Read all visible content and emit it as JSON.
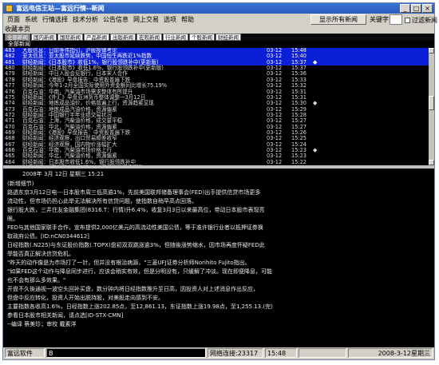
{
  "window": {
    "title": "富远电信王站—富远行情--新闻",
    "min": "_",
    "max": "□",
    "close": "×"
  },
  "menu": [
    "页面",
    "系统",
    "行情选择",
    "技术分析",
    "公告信息",
    "网上交易",
    "选项",
    "帮助"
  ],
  "toolbar": {
    "show_all_button": "显示所有新闻",
    "keyword_label": "关键字:",
    "keyword_value": "",
    "filter_label": "过滤新闻",
    "filter_checked": false
  },
  "breadcrumb": "收藏本页",
  "tabs": [
    {
      "label": "全部新闻",
      "active": true
    },
    {
      "label": "国内新闻",
      "active": false
    },
    {
      "label": "国际新闻",
      "active": false
    },
    {
      "label": "产品新闻",
      "active": false
    },
    {
      "label": "出版新闻",
      "active": false
    },
    {
      "label": "宏观新闻",
      "active": false
    },
    {
      "label": "行业新闻",
      "active": false
    },
    {
      "label": "个股新闻",
      "active": false
    },
    {
      "label": "财经新闻",
      "active": false
    }
  ],
  "list_header": "全部新闻",
  "news": [
    {
      "id": "483",
      "title": "大股信息：日前等伟指引，沪股按律考论",
      "date": "03-12",
      "time": "15:48",
      "mark": "",
      "state": "hl"
    },
    {
      "id": "482",
      "title": "亚太信息：亚太股市延续跌势，中国恒生再跌近1%指数",
      "date": "03-12",
      "time": "15:40",
      "mark": "",
      "state": "hl"
    },
    {
      "id": "481",
      "title": "财经新闻：《日本股市》收低1%，银行股领跌补中(更新版)",
      "date": "03-12",
      "time": "15:37",
      "mark": "◆",
      "state": "sel"
    },
    {
      "id": "480",
      "title": "财经新闻：《日本股市》收低1.6%，银行股领跌补中(更新版)",
      "date": "03-12",
      "time": "15:37",
      "mark": "",
      "state": ""
    },
    {
      "id": "479",
      "title": "财经新闻：中日入股会见银行，日本宋人合作",
      "date": "03-12",
      "time": "15:36",
      "mark": "",
      "state": ""
    },
    {
      "id": "478",
      "title": "财经新闻：《港股》早盘报告：中资股普遍下跌",
      "date": "03-12",
      "time": "15:33",
      "mark": "",
      "state": ""
    },
    {
      "id": "477",
      "title": "财经新闻：今年1-2月全国实际使用外资金额同比增长75.19%",
      "date": "03-12",
      "time": "15:32",
      "mark": "",
      "state": ""
    },
    {
      "id": "476",
      "title": "百克石油：华南，汽柴油市场需求整体有所提升",
      "date": "03-12",
      "time": "15:31",
      "mark": "",
      "state": ""
    },
    {
      "id": "475",
      "title": "财经新闻：《外汇》早盘亚洲货币整体调整一3月12日",
      "date": "03-12",
      "time": "15:31",
      "mark": "",
      "state": ""
    },
    {
      "id": "474",
      "title": "财经新闻：地炼成品油价，价格普遍上行，资源趋紧显现",
      "date": "03-12",
      "time": "15:30",
      "mark": "◆",
      "state": ""
    },
    {
      "id": "473",
      "title": "百克石油：地炼成品汽油价格，资源偏紧",
      "date": "03-12",
      "time": "15:29",
      "mark": "",
      "state": ""
    },
    {
      "id": "472",
      "title": "财经新闻：中国银行半年业绩交易状况",
      "date": "03-12",
      "time": "15:28",
      "mark": "",
      "state": ""
    },
    {
      "id": "471",
      "title": "百克石油：上海，汽柴油价格，成交量平稳",
      "date": "03-12",
      "time": "15:27",
      "mark": "",
      "state": ""
    },
    {
      "id": "470",
      "title": "百克石油：华北，汽柴油价格，资源偏紧",
      "date": "03-12",
      "time": "15:27",
      "mark": "",
      "state": ""
    },
    {
      "id": "469",
      "title": "财经新闻：《港股》早盘报告：中资股普遍下跌",
      "date": "03-12",
      "time": "15:26",
      "mark": "",
      "state": ""
    },
    {
      "id": "468",
      "title": "财经新闻：经济观察，出口贸易顺差收窄",
      "date": "03-12",
      "time": "15:25",
      "mark": "",
      "state": ""
    },
    {
      "id": "467",
      "title": "财经新闻：经济观察，国内物价涨幅扩大",
      "date": "03-12",
      "time": "15:24",
      "mark": "",
      "state": ""
    },
    {
      "id": "466",
      "title": "百克石油：华南，汽柴油市场价格上行",
      "date": "03-12",
      "time": "15:23",
      "mark": "◆",
      "state": ""
    },
    {
      "id": "465",
      "title": "财经新闻：华北，汽柴油价格，资源偏紧",
      "date": "03-12",
      "time": "15:23",
      "mark": "",
      "state": ""
    },
    {
      "id": "464",
      "title": "财经新闻：日本股市收低1.6%，银行股领跌补中",
      "date": "03-12",
      "time": "15:22",
      "mark": "",
      "state": ""
    },
    {
      "id": "463",
      "title": "财经新闻：《日本股市》收低1.6%日经指数早盘下跌",
      "date": "03-12",
      "time": "15:21",
      "mark": "",
      "state": ""
    },
    {
      "id": "462",
      "title": "财经新闻：《日本股市》收低1.6%日盘中升幅扭转，银行股走势强劲",
      "date": "03-12",
      "time": "15:21",
      "mark": "",
      "state": "hl"
    },
    {
      "id": "461",
      "title": "财经新闻：《外汇》早盘报告，外汇价格走低",
      "date": "03-12",
      "time": "15:20",
      "mark": "",
      "state": ""
    },
    {
      "id": "460",
      "title": "财经新闻：《全球外汇动态》—亚洲收市：美元受获利了结打压下滑—3月1…",
      "date": "03-12",
      "time": "15:19",
      "mark": "",
      "state": ""
    }
  ],
  "article": {
    "date_line": "2008年 3月 12日 星期三 15:21",
    "body": [
      "(新增细节)",
      "  路透东京3月12日电---日本股市周三低高逾1%，先前美国联邦储备理事会(FED)出手提供信贷市场更多",
      "流动性，但市场仍担心此举无法解决所有信贷问题，使指数自稍早高点回落。",
      "  银行股大跌，三井住友金融集团(8316.T：行情)升6.4%，收复3月3日以来最高位，带动日本股市表现亮",
      "眼。",
      "  FED与其他国家联手合作，宣布提供2,000亿美元的高流动性美国公债，等于准许银行业者以抵押证券换",
      "取政府公债。[ID:nCN0344612]",
      "  日经指数(.N225)与东证股价指数(.TOPX)盘初双双跳涨逾3%，但随後涨势缩水，因市场再度怀疑FED此",
      "举能否真正解决信贷危机。",
      "  \"昨天的动作像是为市场打了一针，但并没有根治病源，\"三菱UFJ证券分析师Norihito Fujito指出。",
      "  \"如果FED这个动作与降息同步进行，应该会稍实有效，但是分明没有，只缓解了冲淡。现在即便降息，可能",
      "也不会有那么多效果。\"",
      "  开盘不久後通视一波空头回补买盘，数分钟内将日经指数推升至日高，因投资人对上述消息作出反应，",
      "但盘中反应转化，投资人开始出脱持股，对美股走向感到不安。",
      "  主要指数各收高1.6%，日经指数上涨202.85点，至12,861.13，东证指数上涨19.98点，至1,255.13.(完)",
      "  参看日本股市相关新闻，请点选[ID-STX-CMN]",
      "  --编译 蔡美珍；审校 戴素洋"
    ]
  },
  "status": {
    "app": "富远软件",
    "app_extra": "B",
    "connection": "网络连接:23317",
    "time": "15:48",
    "date": "2008-3-12星期三"
  }
}
